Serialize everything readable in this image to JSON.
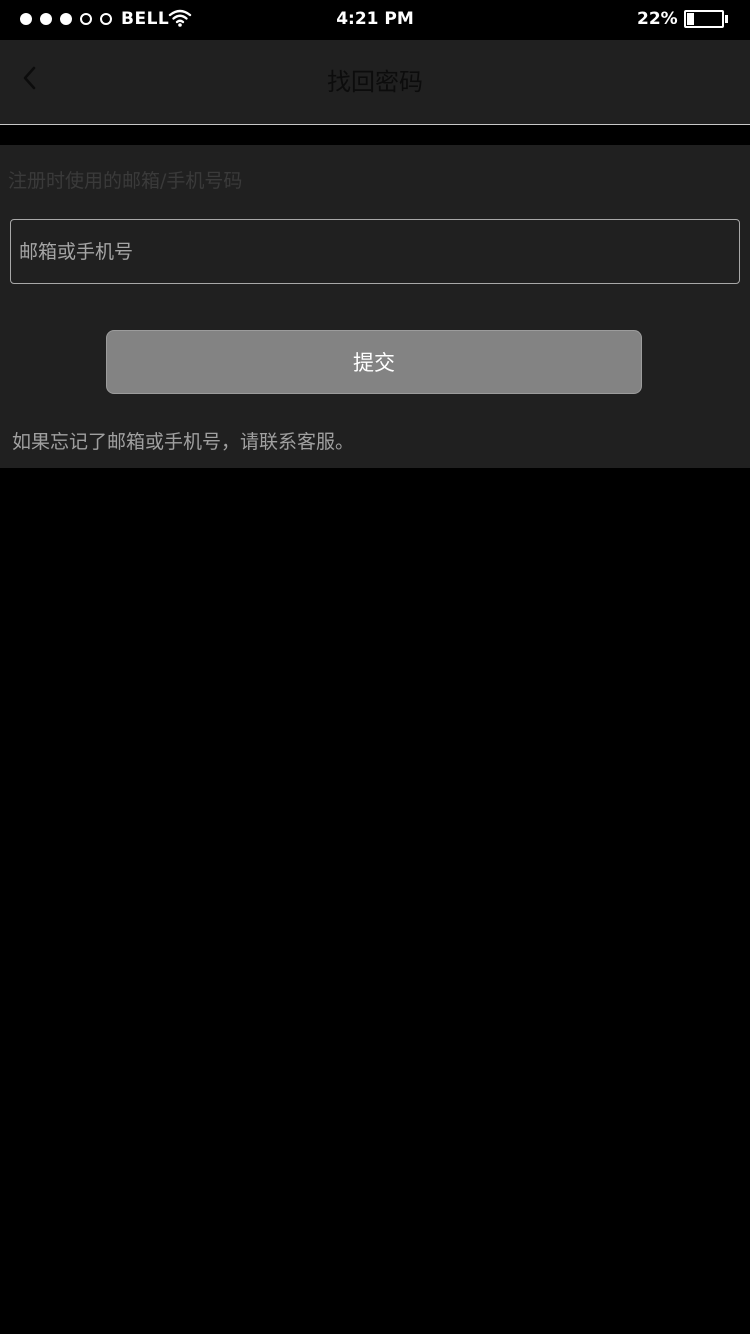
{
  "status_bar": {
    "carrier": "BELL",
    "time": "4:21 PM",
    "battery_percent": "22%",
    "battery_level": 0.22,
    "signal_filled": 3,
    "signal_total": 5,
    "wifi_icon": "wifi-icon"
  },
  "nav": {
    "title": "找回密码",
    "back_icon": "chevron-left-icon"
  },
  "form": {
    "hint_label": "注册时使用的邮箱/手机号码",
    "account_input": {
      "value": "",
      "placeholder": "邮箱或手机号"
    },
    "submit_label": "提交",
    "footer_note": "如果忘记了邮箱或手机号，请联系客服。"
  },
  "colors": {
    "page_background": "#000000",
    "panel_background": "#202020",
    "button_background": "#838383",
    "input_border": "#a8a8a8",
    "divider": "#c8c8c8"
  }
}
